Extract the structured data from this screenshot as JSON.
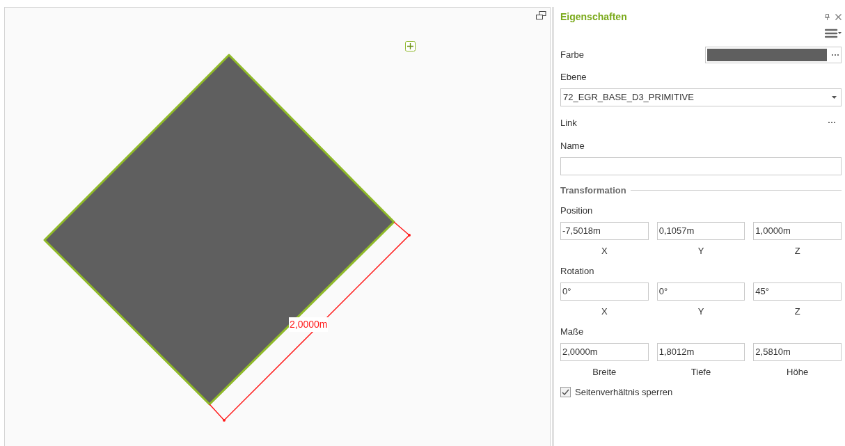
{
  "viewport": {
    "dimension_label": "2,0000m"
  },
  "panel": {
    "title": "Eigenschaften",
    "rows": [
      {
        "kind": "color",
        "label": "Farbe",
        "color": "#5f5f5f"
      },
      {
        "kind": "dropdown",
        "label": "Ebene",
        "value": "72_EGR_BASE_D3_PRIMITIVE"
      },
      {
        "kind": "link",
        "label": "Link"
      },
      {
        "kind": "text",
        "label": "Name"
      },
      {
        "kind": "section",
        "label": "Transformation"
      },
      {
        "kind": "triple",
        "label": "Position",
        "values": [
          "-7,5018m",
          "0,1057m",
          "1,0000m"
        ],
        "captions": [
          "X",
          "Y",
          "Z"
        ]
      },
      {
        "kind": "triple",
        "label": "Rotation",
        "values": [
          "0°",
          "0°",
          "45°"
        ],
        "captions": [
          "X",
          "Y",
          "Z"
        ]
      },
      {
        "kind": "triple",
        "label": "Maße",
        "values": [
          "2,0000m",
          "1,8012m",
          "2,5810m"
        ],
        "captions": [
          "Breite",
          "Tiefe",
          "Höhe"
        ]
      },
      {
        "kind": "checkbox",
        "label": "Seitenverhältnis sperren",
        "checked": true
      }
    ]
  }
}
